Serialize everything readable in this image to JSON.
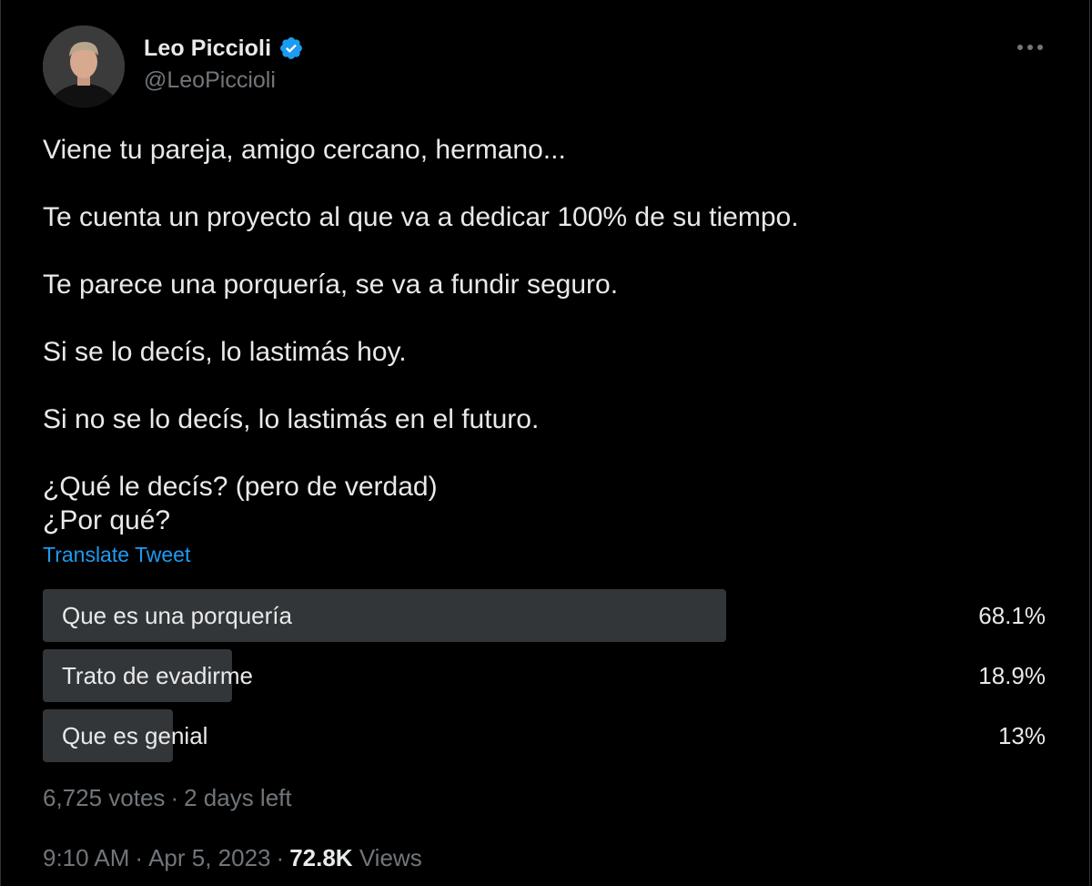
{
  "author": {
    "display_name": "Leo Piccioli",
    "handle": "@LeoPiccioli",
    "verified": true,
    "verified_icon": "verified-badge-icon",
    "verified_color": "#1d9bf0"
  },
  "more_menu_icon": "more-horizontal-icon",
  "tweet": {
    "paragraphs": [
      "Viene tu pareja, amigo cercano, hermano...",
      "Te cuenta un proyecto al que va a dedicar 100% de su tiempo.",
      "Te parece una porquería, se va a fundir seguro.",
      "Si se lo decís, lo lastimás hoy.",
      "Si no se lo decís, lo lastimás en el futuro.",
      "¿Qué le decís? (pero de verdad)",
      "¿Por qué?"
    ],
    "translate_label": "Translate Tweet"
  },
  "poll": {
    "options": [
      {
        "label": "Que es una porquería",
        "percent_text": "68.1%",
        "percent": 68.1
      },
      {
        "label": "Trato de evadirme",
        "percent_text": "18.9%",
        "percent": 18.9
      },
      {
        "label": "Que es genial",
        "percent_text": "13%",
        "percent": 13
      }
    ],
    "votes": "6,725 votes",
    "time_left": "2 days left"
  },
  "footer": {
    "time": "9:10 AM",
    "date": "Apr 5, 2023",
    "views_count": "72.8K",
    "views_label": "Views"
  },
  "colors": {
    "background": "#000000",
    "text": "#e7e9ea",
    "secondary_text": "#71767b",
    "link": "#1d9bf0",
    "poll_bar": "#333639"
  }
}
